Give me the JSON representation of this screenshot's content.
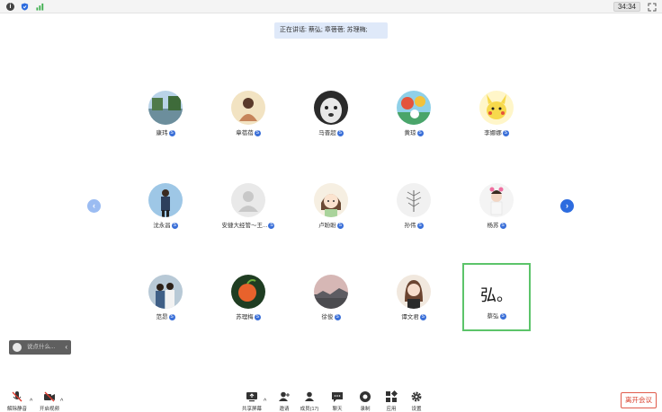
{
  "topbar": {
    "timer": "34:34",
    "icons": [
      "info-icon",
      "shield-icon",
      "signal-icon",
      "fullscreen-icon"
    ]
  },
  "speaking_banner": "正在讲话: 蔡弘; 章蓓蓓; 苏理梅;",
  "participants": [
    {
      "name": "康玮",
      "avatar": "lake-photo"
    },
    {
      "name": "章蓓蓓",
      "avatar": "person-sitting"
    },
    {
      "name": "马晋超",
      "avatar": "dog-face"
    },
    {
      "name": "黄琼",
      "avatar": "colorful-scene"
    },
    {
      "name": "李娜娜",
      "avatar": "pikachu"
    },
    {
      "name": "沈永昌",
      "avatar": "person-standing"
    },
    {
      "name": "安捷大经管～王...",
      "avatar": "default-person"
    },
    {
      "name": "卢盼盼",
      "avatar": "cartoon-girl"
    },
    {
      "name": "孙伟",
      "avatar": "tree"
    },
    {
      "name": "杨苏",
      "avatar": "child"
    },
    {
      "name": "范昂",
      "avatar": "couple"
    },
    {
      "name": "苏理梅",
      "avatar": "orange-fruit"
    },
    {
      "name": "徐俊",
      "avatar": "sunset"
    },
    {
      "name": "谭文君",
      "avatar": "woman-portrait"
    },
    {
      "name": "蔡弘",
      "avatar": "text",
      "avatar_text": "弘。",
      "active": true
    }
  ],
  "badge_glyph": "S",
  "nav": {
    "prev": "‹",
    "next": "›"
  },
  "chat": {
    "placeholder": "说点什么...",
    "collapse": "‹"
  },
  "toolbar": {
    "unmute": "解除静音",
    "start_video": "开启视频",
    "share_screen": "共享屏幕",
    "invite": "邀请",
    "members": "成员(17)",
    "chat": "聊天",
    "record": "录制",
    "apps": "应用",
    "settings": "设置",
    "caret": "^"
  },
  "leave_button": "离开会议",
  "colors": {
    "accent": "#2d6cdf",
    "active_border": "#5cc46a",
    "leave": "#d9422f"
  }
}
